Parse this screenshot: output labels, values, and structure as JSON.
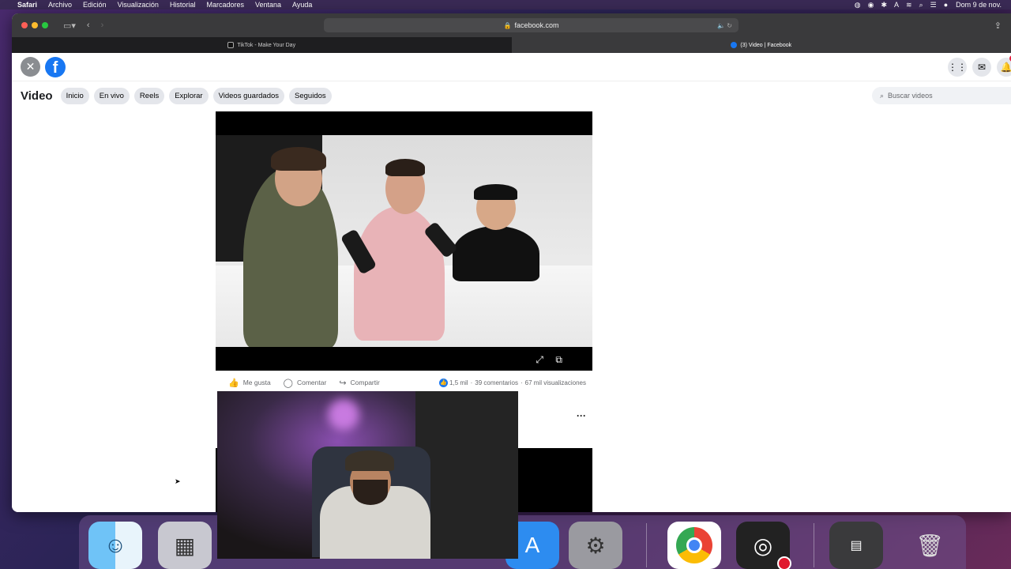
{
  "menubar": {
    "apple": "",
    "items": [
      "Safari",
      "Archivo",
      "Edición",
      "Visualización",
      "Historial",
      "Marcadores",
      "Ventana",
      "Ayuda"
    ],
    "clock": "Dom 9 de nov."
  },
  "browser": {
    "address": "facebook.com",
    "tabs": [
      {
        "label": "TikTok - Make Your Day"
      },
      {
        "label": "(3) Video | Facebook"
      }
    ]
  },
  "facebook": {
    "logo_letter": "f",
    "nav_title": "Video",
    "nav_items": [
      "Inicio",
      "En vivo",
      "Reels",
      "Explorar",
      "Videos guardados",
      "Seguidos"
    ],
    "search_placeholder": "Buscar videos",
    "actions": {
      "like": "Me gusta",
      "comment": "Comentar",
      "share": "Compartir"
    },
    "stats": {
      "likes": "1,5 mil",
      "comments": "39 comentarios",
      "views": "67 mil visualizaciones"
    },
    "more": "···"
  },
  "colors": {
    "fb_blue": "#1877f2",
    "pill_bg": "#e4e6eb",
    "menubar_bg": "#3a2a55"
  },
  "icons": {
    "close": "close-icon",
    "grid": "grid-icon",
    "messenger": "messenger-icon",
    "bell": "bell-icon",
    "search": "search-icon"
  }
}
